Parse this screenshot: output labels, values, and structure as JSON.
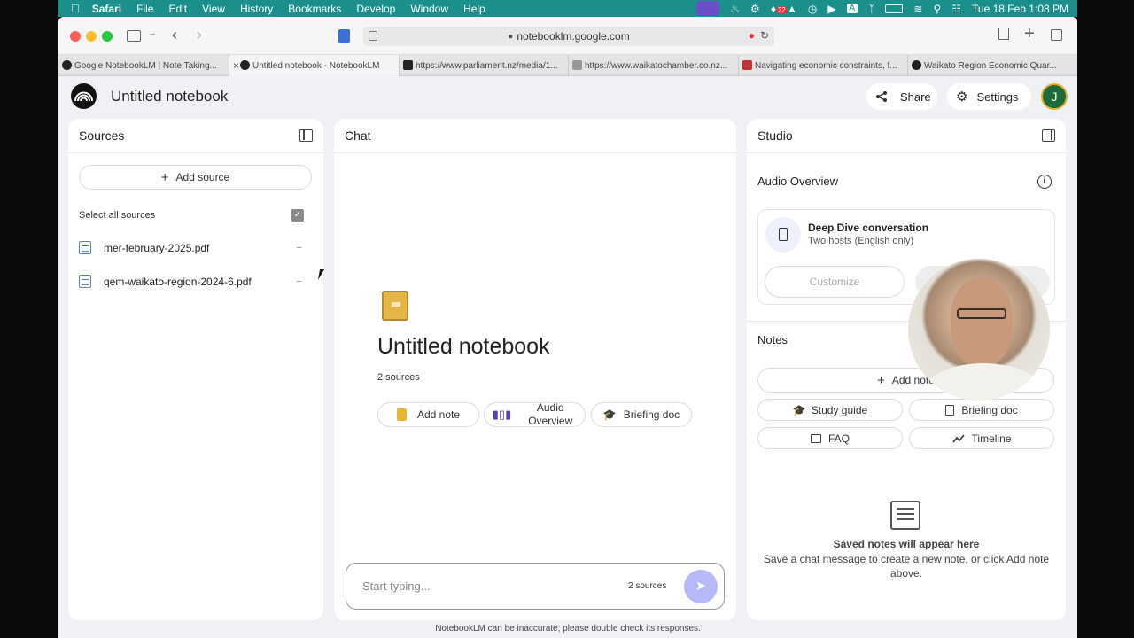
{
  "menubar": {
    "app": "Safari",
    "items": [
      "File",
      "Edit",
      "View",
      "History",
      "Bookmarks",
      "Develop",
      "Window",
      "Help"
    ],
    "clock": "Tue 18 Feb  1:08 PM",
    "badge": "22"
  },
  "browser": {
    "url": "notebooklm.google.com",
    "tabs": [
      "Google NotebookLM | Note Taking...",
      "Untitled notebook - NotebookLM",
      "https://www.parliament.nz/media/1...",
      "https://www.waikatochamber.co.nz...",
      "Navigating economic constraints, f...",
      "Waikato Region Economic Quar..."
    ]
  },
  "app": {
    "title": "Untitled notebook",
    "share": "Share",
    "settings": "Settings",
    "avatar": "J",
    "footer": "NotebookLM can be inaccurate; please double check its responses."
  },
  "sources": {
    "title": "Sources",
    "add": "Add source",
    "select_all": "Select all sources",
    "files": [
      "mer-february-2025.pdf",
      "qem-waikato-region-2024-6.pdf"
    ]
  },
  "chat": {
    "title": "Chat",
    "heading": "Untitled notebook",
    "count": "2 sources",
    "btn_note": "Add note",
    "btn_audio": "Audio Overview",
    "btn_brief": "Briefing doc",
    "placeholder": "Start typing...",
    "input_count": "2 sources"
  },
  "studio": {
    "title": "Studio",
    "audio_title": "Audio Overview",
    "deep": "Deep Dive conversation",
    "hosts": "Two hosts (English only)",
    "customize": "Customize",
    "notes": "Notes",
    "add_note": "Add note",
    "study": "Study guide",
    "briefing": "Briefing doc",
    "faq": "FAQ",
    "timeline": "Timeline",
    "empty_title": "Saved notes will appear here",
    "empty_desc": "Save a chat message to create a new note, or click Add note above."
  }
}
